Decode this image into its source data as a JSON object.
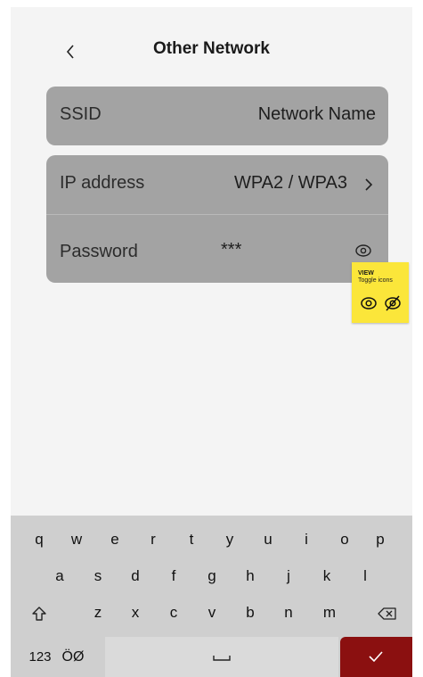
{
  "header": {
    "title": "Other Network",
    "back_icon": "chevron-left-icon"
  },
  "ssid_row": {
    "label": "SSID",
    "value": "Network Name"
  },
  "security_row": {
    "label": "IP address",
    "value": "WPA2 / WPA3",
    "icon": "chevron-right-icon"
  },
  "password_row": {
    "label": "Password",
    "value": "***",
    "icon": "eye-icon"
  },
  "note": {
    "title": "VIEW",
    "subtitle": "Toggle icons",
    "icons": [
      "eye-icon",
      "eye-off-icon"
    ]
  },
  "keyboard": {
    "row1": [
      "q",
      "w",
      "e",
      "r",
      "t",
      "y",
      "u",
      "i",
      "o",
      "p"
    ],
    "row2": [
      "a",
      "s",
      "d",
      "f",
      "g",
      "h",
      "j",
      "k",
      "l"
    ],
    "row3": [
      "z",
      "x",
      "c",
      "v",
      "b",
      "n",
      "m"
    ],
    "numbers_key": "123",
    "alt_key": "ÖØ",
    "shift_icon": "shift-icon",
    "backspace_icon": "backspace-icon",
    "space_icon": "space-icon",
    "enter_icon": "checkmark-icon",
    "enter_color": "#8b1010"
  }
}
